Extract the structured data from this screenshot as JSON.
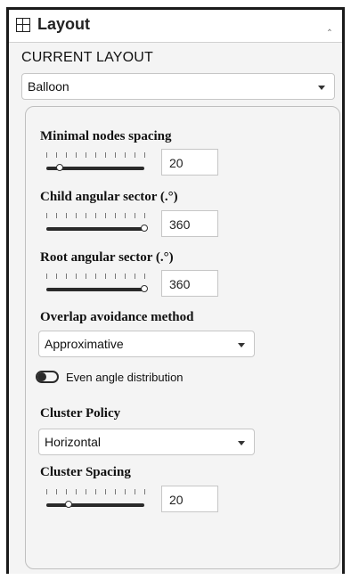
{
  "header": {
    "title": "Layout",
    "icon": "grid-icon",
    "collapse_icon": "chevron-up-icon"
  },
  "current_layout": {
    "title": "CURRENT LAYOUT",
    "selected": "Balloon"
  },
  "settings": {
    "min_nodes_spacing": {
      "label": "Minimal nodes spacing",
      "value": "20",
      "slider_level": 0.1
    },
    "child_angular": {
      "label": "Child angular sector (.°)",
      "value": "360",
      "slider_level": 1.0
    },
    "root_angular": {
      "label": "Root angular sector (.°)",
      "value": "360",
      "slider_level": 1.0
    },
    "overlap": {
      "label": "Overlap avoidance method",
      "selected": "Approximative"
    },
    "even_angle": {
      "label": "Even angle distribution",
      "enabled": false
    },
    "cluster_policy": {
      "label": "Cluster Policy",
      "selected": "Horizontal"
    },
    "cluster_spacing": {
      "label": "Cluster Spacing",
      "value": "20",
      "slider_level": 0.2
    }
  }
}
